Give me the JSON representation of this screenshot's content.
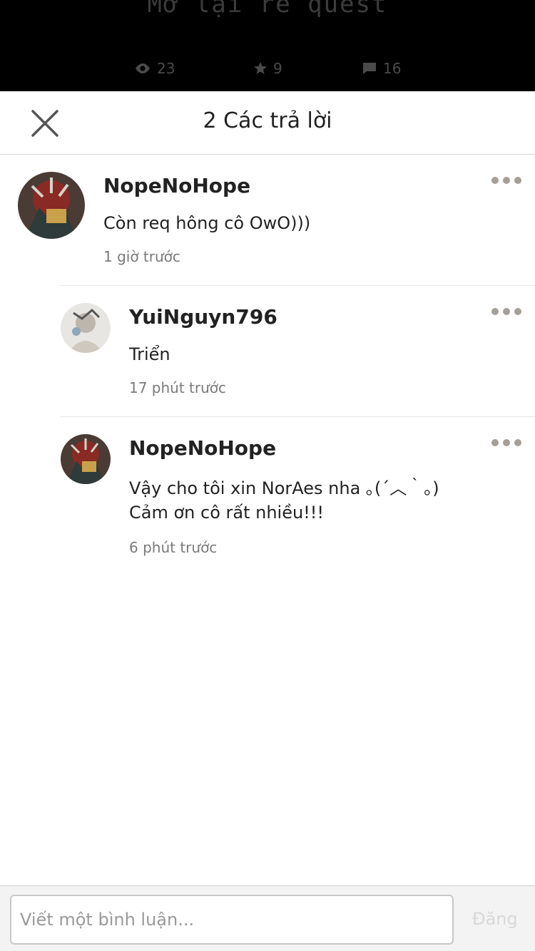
{
  "backdrop": {
    "title": "Mở lại re quest",
    "stats": {
      "views": "23",
      "votes": "9",
      "comments": "16"
    }
  },
  "header": {
    "title": "2 Các trả lời"
  },
  "comments": [
    {
      "username": "NopeNoHope",
      "text": "Còn req hông cô OwO)))",
      "time": "1 giờ trước"
    },
    {
      "username": "YuiNguyn796",
      "text": "Triển",
      "time": "17 phút trước"
    },
    {
      "username": "NopeNoHope",
      "text": "Vậy cho tôi xin NorAes nha ｡(´︿｀｡)\nCảm ơn cô rất nhiều!!!",
      "time": "6 phút trước"
    }
  ],
  "composer": {
    "placeholder": "Viết một bình luận...",
    "post_label": "Đăng"
  },
  "colors": {
    "backdrop": "#000000",
    "text": "#222222",
    "muted": "#7a7a7a",
    "more_dots": "#a59f99",
    "post_disabled": "#d8d8d8"
  }
}
